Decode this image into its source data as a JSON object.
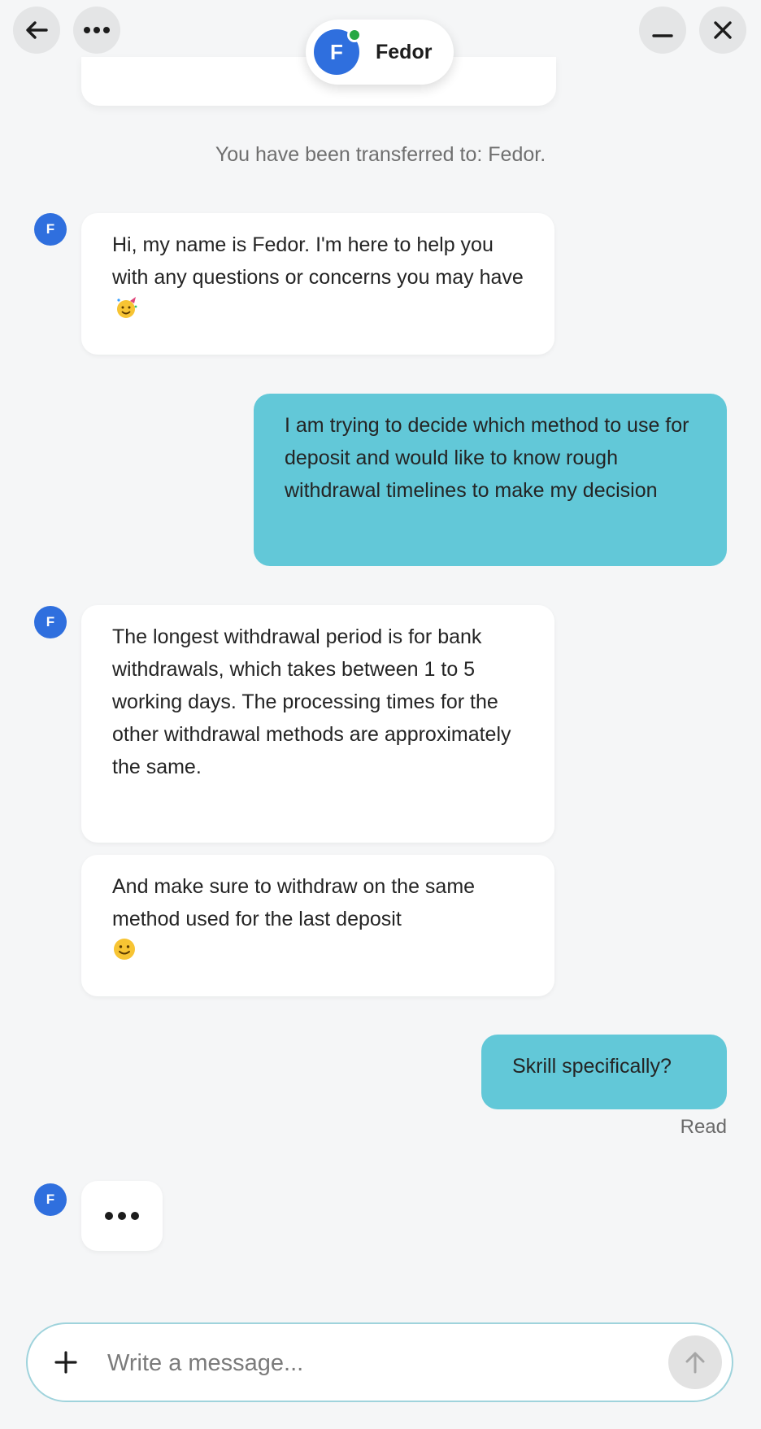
{
  "header": {
    "agent_name": "Fedor",
    "agent_initial": "F",
    "back_icon": "arrow-left-icon",
    "more_icon": "more-horizontal-icon",
    "minimize_icon": "minus-icon",
    "close_icon": "close-icon"
  },
  "system_message": "You have been transferred to: Fedor.",
  "messages": [
    {
      "sender": "agent",
      "avatar": "F",
      "text": "Hi, my name is Fedor. I'm here to help you with any questions or concerns you may have",
      "emoji": "partying-face-icon"
    },
    {
      "sender": "user",
      "text": "I am trying to decide which method to use for deposit and would like to know rough withdrawal timelines to make my decision"
    },
    {
      "sender": "agent",
      "avatar": "F",
      "text": "The longest withdrawal period is for bank withdrawals, which takes between 1 to 5 working days. The processing times for the other withdrawal methods are approximately the same."
    },
    {
      "sender": "agent",
      "text": "And make sure to withdraw on the same method used for the last deposit",
      "emoji": "slightly-smiling-face-icon"
    },
    {
      "sender": "user",
      "text": "Skrill specifically?"
    }
  ],
  "read_receipt": "Read",
  "typing": {
    "avatar": "F",
    "indicator_icon": "typing-dots-icon"
  },
  "composer": {
    "placeholder": "Write a message...",
    "value": "",
    "attach_icon": "plus-icon",
    "send_icon": "arrow-up-icon"
  },
  "colors": {
    "background": "#f5f6f7",
    "brand_blue": "#2f6fde",
    "user_bubble": "#62c8d8",
    "online_green": "#27a844",
    "composer_border": "#9fd3dc"
  }
}
